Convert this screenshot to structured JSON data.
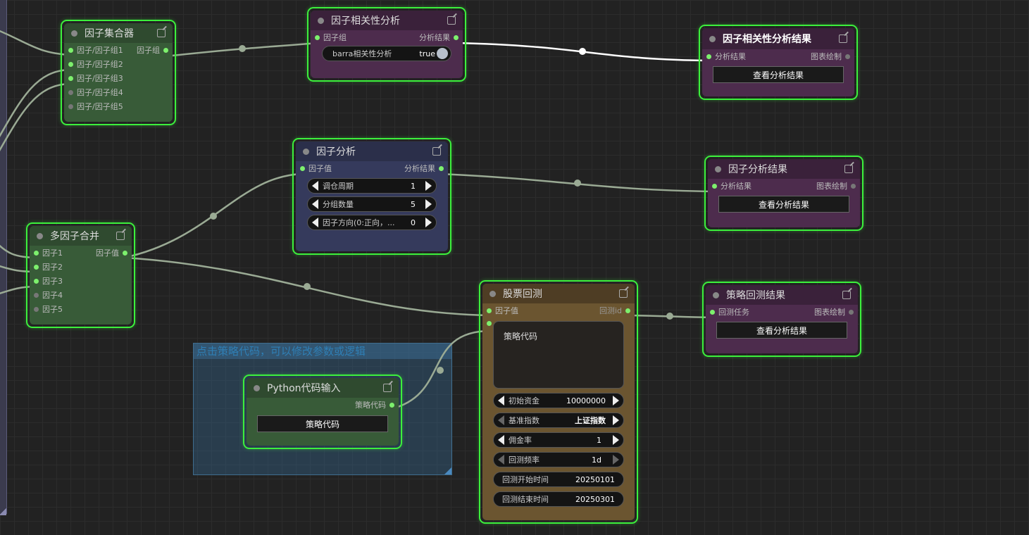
{
  "group": {
    "title": "点击策略代码，可以修改参数或逻辑"
  },
  "factor_collector": {
    "title": "因子集合器",
    "inputs": [
      "因子/因子组1",
      "因子/因子组2",
      "因子/因子组3",
      "因子/因子组4",
      "因子/因子组5"
    ],
    "output": "因子组"
  },
  "correlation": {
    "title": "因子相关性分析",
    "input": "因子组",
    "output": "分析结果",
    "toggle_label": "barra相关性分析",
    "toggle_value": "true"
  },
  "correlation_result": {
    "title": "因子相关性分析结果",
    "input": "分析结果",
    "output": "图表绘制",
    "button": "查看分析结果"
  },
  "factor_analysis": {
    "title": "因子分析",
    "input": "因子值",
    "output": "分析结果",
    "widgets": [
      {
        "label": "调仓周期",
        "value": "1"
      },
      {
        "label": "分组数量",
        "value": "5"
      },
      {
        "label": "因子方向(0:正向，...",
        "value": "0"
      }
    ]
  },
  "factor_result": {
    "title": "因子分析结果",
    "input": "分析结果",
    "output": "图表绘制",
    "button": "查看分析结果"
  },
  "multi_merge": {
    "title": "多因子合并",
    "inputs": [
      "因子1",
      "因子2",
      "因子3",
      "因子4",
      "因子5"
    ],
    "output": "因子值"
  },
  "backtest": {
    "title": "股票回测",
    "input": "因子值",
    "output": "回测id",
    "code_label": "策略代码",
    "widgets": [
      {
        "label": "初始资金",
        "value": "10000000"
      },
      {
        "label": "基准指数",
        "value": "上证指数"
      },
      {
        "label": "佣金率",
        "value": "1"
      },
      {
        "label": "回测频率",
        "value": "1d"
      }
    ],
    "text_fields": [
      {
        "label": "回测开始时间",
        "value": "20250101"
      },
      {
        "label": "回测结束时间",
        "value": "20250301"
      }
    ]
  },
  "backtest_result": {
    "title": "策略回测结果",
    "input": "回测任务",
    "output": "图表绘制",
    "button": "查看分析结果"
  },
  "python_input": {
    "title": "Python代码输入",
    "output": "策略代码",
    "button": "策略代码"
  },
  "colors": {
    "canvas": "#222222",
    "node_border": "#3cf03c",
    "pin_active": "#7df06d",
    "wire": "#9aaa94",
    "wire_highlight": "#ffffff"
  }
}
